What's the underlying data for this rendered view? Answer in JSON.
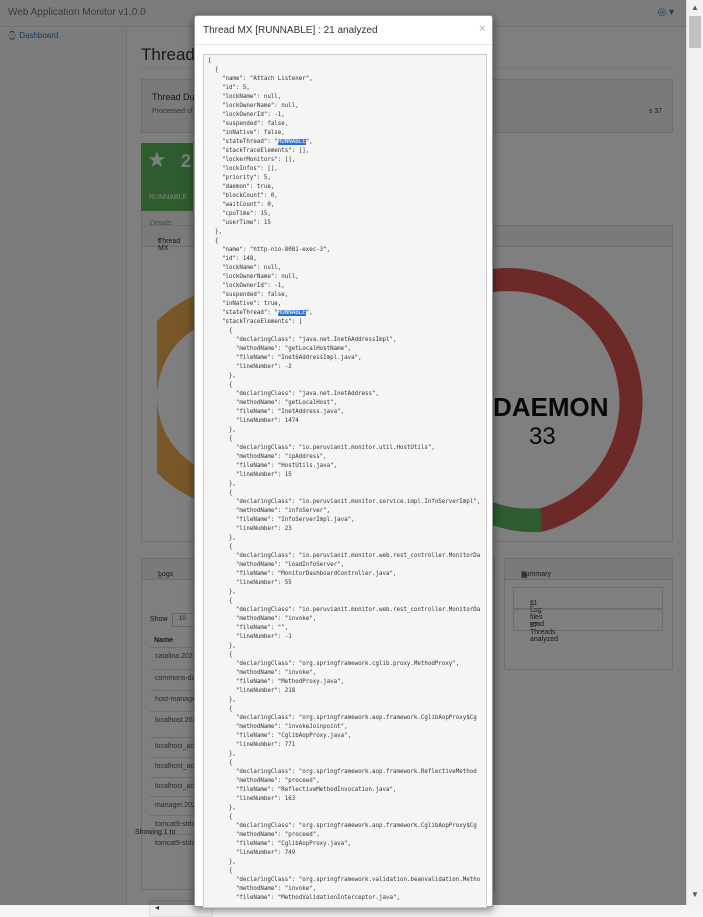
{
  "app": {
    "brand": "Web Application Monitor v1.0.0",
    "user_menu_icon": "user-circle-icon"
  },
  "sidebar": {
    "dashboard_label": "Dashboard",
    "dashboard_icon": "dashboard-icon"
  },
  "page": {
    "title": "Thread",
    "info_title": "Thread Du",
    "info_processed": "Processed of",
    "info_count": "s 37"
  },
  "cards": {
    "runnable_value": "2",
    "runnable_label": "RUNNABLE",
    "details_label": "Details"
  },
  "chart_panel": {
    "header": "Thread MX",
    "donut_label": "DAEMON",
    "donut_value": "33",
    "colors": {
      "left": "#f0ad4e",
      "red": "#d9534f",
      "green": "#5cb85c"
    }
  },
  "logs": {
    "header": "Logs",
    "show_label": "Show",
    "show_value": "10",
    "column_name": "Name",
    "rows": [
      "catalina.2021",
      "commons-da",
      "host-manage",
      "localhost.202",
      "localhost_ac",
      "localhost_ac",
      "localhost_ac",
      "manager.202",
      "tomcat9-stdo",
      "tomcat9-stdo"
    ],
    "showing": "Showing 1 to",
    "scroll_left": "◂"
  },
  "summary": {
    "header": "Summary",
    "log_files": "11 Log files read",
    "threads": "37 Threads analyzed"
  },
  "modal": {
    "title": "Thread MX [RUNNABLE] : 21 analyzed",
    "close": "×",
    "lines": [
      "[",
      "  {",
      "    \"name\": \"Attach Listener\",",
      "    \"id\": 5,",
      "    \"lockName\": null,",
      "    \"lockOwnerName\": null,",
      "    \"lockOwnerId\": -1,",
      "    \"suspended\": false,",
      "    \"inNative\": false,",
      "    \"stateThread\": \"RUNNABLE\",",
      "    \"stackTraceElements\": [],",
      "    \"lockerMonitors\": [],",
      "    \"lockInfos\": [],",
      "    \"priority\": 5,",
      "    \"daemon\": true,",
      "    \"blockCount\": 0,",
      "    \"waitCount\": 0,",
      "    \"cpuTime\": 15,",
      "    \"userTime\": 15",
      "  },",
      "  {",
      "    \"name\": \"http-nio-8081-exec-3\",",
      "    \"id\": 148,",
      "    \"lockName\": null,",
      "    \"lockOwnerName\": null,",
      "    \"lockOwnerId\": -1,",
      "    \"suspended\": false,",
      "    \"inNative\": true,",
      "    \"stateThread\": \"RUNNABLE\",",
      "    \"stackTraceElements\": [",
      "      {",
      "        \"declaringClass\": \"java.net.Inet6AddressImpl\",",
      "        \"methodName\": \"getLocalHostName\",",
      "        \"fileName\": \"Inet6AddressImpl.java\",",
      "        \"lineNumber\": -2",
      "      },",
      "      {",
      "        \"declaringClass\": \"java.net.InetAddress\",",
      "        \"methodName\": \"getLocalHost\",",
      "        \"fileName\": \"InetAddress.java\",",
      "        \"lineNumber\": 1474",
      "      },",
      "      {",
      "        \"declaringClass\": \"io.peruvianit.monitor.util.HostUtils\",",
      "        \"methodName\": \"ipAddress\",",
      "        \"fileName\": \"HostUtils.java\",",
      "        \"lineNumber\": 15",
      "      },",
      "      {",
      "        \"declaringClass\": \"io.peruvianit.monitor.service.impl.InfoServerImpl\",",
      "        \"methodName\": \"infoServer\",",
      "        \"fileName\": \"InfoServerImpl.java\",",
      "        \"lineNumber\": 23",
      "      },",
      "      {",
      "        \"declaringClass\": \"io.peruvianit.monitor.web.rest_controller.MonitorDa",
      "        \"methodName\": \"loadInfoServer\",",
      "        \"fileName\": \"MonitorDashboardController.java\",",
      "        \"lineNumber\": 55",
      "      },",
      "      {",
      "        \"declaringClass\": \"io.peruvianit.monitor.web.rest_controller.MonitorDa",
      "        \"methodName\": \"invoke\",",
      "        \"fileName\": \"\",",
      "        \"lineNumber\": -1",
      "      },",
      "      {",
      "        \"declaringClass\": \"org.springframework.cglib.proxy.MethodProxy\",",
      "        \"methodName\": \"invoke\",",
      "        \"fileName\": \"MethodProxy.java\",",
      "        \"lineNumber\": 218",
      "      },",
      "      {",
      "        \"declaringClass\": \"org.springframework.aop.framework.CglibAopProxy$Cg",
      "        \"methodName\": \"invokeJoinpoint\",",
      "        \"fileName\": \"CglibAopProxy.java\",",
      "        \"lineNumber\": 771",
      "      },",
      "      {",
      "        \"declaringClass\": \"org.springframework.aop.framework.ReflectiveMethod",
      "        \"methodName\": \"proceed\",",
      "        \"fileName\": \"ReflectiveMethodInvocation.java\",",
      "        \"lineNumber\": 163",
      "      },",
      "      {",
      "        \"declaringClass\": \"org.springframework.aop.framework.CglibAopProxy$Cg",
      "        \"methodName\": \"proceed\",",
      "        \"fileName\": \"CglibAopProxy.java\",",
      "        \"lineNumber\": 749",
      "      },",
      "      {",
      "        \"declaringClass\": \"org.springframework.validation.beanvalidation.Metho",
      "        \"methodName\": \"invoke\",",
      "        \"fileName\": \"MethodValidationInterceptor.java\","
    ],
    "highlight": "RUNNABLE"
  }
}
